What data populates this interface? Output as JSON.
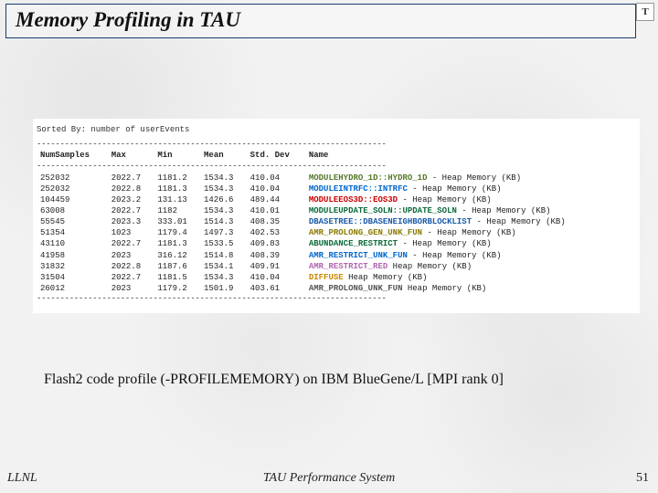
{
  "title": "Memory Profiling in TAU",
  "badge": "T",
  "sort_line": "Sorted By: number of userEvents",
  "dash": "---------------------------------------------------------------------------",
  "columns": [
    "NumSamples",
    "Max",
    "Min",
    "Mean",
    "Std. Dev",
    "Name"
  ],
  "name_colors": {
    "MODULEHYDRO_1D::HYDRO_1D": "#557a2a",
    "MODULEINTRFC::INTRFC": "#0066cc",
    "MODULEEOS3D::EOS3D": "#cc0000",
    "MODULEUPDATE_SOLN::UPDATE_SOLN": "#0a6b3a",
    "DBASETREE::DBASENEIGHBORBLOCKLIST": "#1a5aa8",
    "AMR_PROLONG_GEN_UNK_FUN": "#8a7a00",
    "ABUNDANCE_RESTRICT": "#0a6b3a",
    "AMR_RESTRICT_UNK_FUN": "#0066cc",
    "AMR_RESTRICT_RED": "#b066b0",
    "DIFFUSE": "#cc8800",
    "AMR_PROLONG_UNK_FUN": "#555555"
  },
  "rows": [
    {
      "samples": "252032",
      "max": "2022.7",
      "min": "1181.2",
      "mean": "1534.3",
      "std": "410.04",
      "fn": "MODULEHYDRO_1D::HYDRO_1D",
      "suffix": "  - Heap Memory (KB)"
    },
    {
      "samples": "252032",
      "max": "2022.8",
      "min": "1181.3",
      "mean": "1534.3",
      "std": "410.04",
      "fn": "MODULEINTRFC::INTRFC",
      "suffix": "  - Heap Memory (KB)"
    },
    {
      "samples": "104459",
      "max": "2023.2",
      "min": "131.13",
      "mean": "1426.6",
      "std": "489.44",
      "fn": "MODULEEOS3D::EOS3D",
      "suffix": "  - Heap Memory (KB)"
    },
    {
      "samples": "63008",
      "max": "2022.7",
      "min": "1182",
      "mean": "1534.3",
      "std": "410.01",
      "fn": "MODULEUPDATE_SOLN::UPDATE_SOLN",
      "suffix": "  - Heap Memory (KB)"
    },
    {
      "samples": "55545",
      "max": "2023.3",
      "min": "333.01",
      "mean": "1514.3",
      "std": "408.35",
      "fn": "DBASETREE::DBASENEIGHBORBLOCKLIST",
      "suffix": "  - Heap Memory (KB)"
    },
    {
      "samples": "51354",
      "max": "1023",
      "min": "1179.4",
      "mean": "1497.3",
      "std": "402.53",
      "fn": "AMR_PROLONG_GEN_UNK_FUN",
      "suffix": "  - Heap Memory (KB)"
    },
    {
      "samples": "43110",
      "max": "2022.7",
      "min": "1181.3",
      "mean": "1533.5",
      "std": "409.83",
      "fn": "ABUNDANCE_RESTRICT",
      "suffix": "   - Heap Memory (KB)"
    },
    {
      "samples": "41958",
      "max": "2023",
      "min": "316.12",
      "mean": "1514.8",
      "std": "408.39",
      "fn": "AMR_RESTRICT_UNK_FUN",
      "suffix": "  - Heap Memory (KB)"
    },
    {
      "samples": "31832",
      "max": "2022.8",
      "min": "1187.6",
      "mean": "1534.1",
      "std": "409.91",
      "fn": "AMR_RESTRICT_RED",
      "suffix": "    Heap Memory (KB)"
    },
    {
      "samples": "31504",
      "max": "2022.7",
      "min": "1181.5",
      "mean": "1534.3",
      "std": "410.04",
      "fn": "DIFFUSE",
      "suffix": "    Heap Memory (KB)"
    },
    {
      "samples": "26012",
      "max": "2023",
      "min": "1179.2",
      "mean": "1501.9",
      "std": "403.61",
      "fn": "AMR_PROLONG_UNK_FUN",
      "suffix": "    Heap Memory (KB)"
    }
  ],
  "caption": "Flash2 code profile (-PROFILEMEMORY) on IBM BlueGene/L [MPI rank 0]",
  "footer": {
    "left": "LLNL",
    "center": "TAU Performance System",
    "right": "51"
  }
}
